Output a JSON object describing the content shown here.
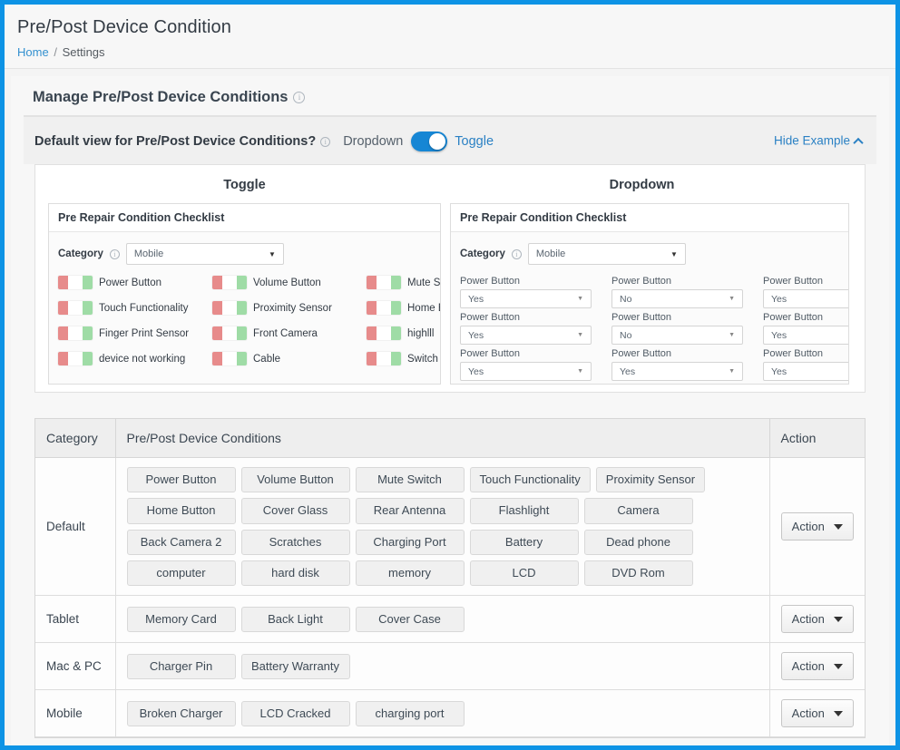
{
  "header": {
    "title": "Pre/Post Device Condition",
    "breadcrumb": {
      "home": "Home",
      "separator": "/",
      "current": "Settings"
    }
  },
  "card": {
    "title": "Manage Pre/Post Device Conditions"
  },
  "default_view": {
    "label": "Default view for Pre/Post Device Conditions?",
    "option_off": "Dropdown",
    "option_on": "Toggle",
    "toggle_state": "on",
    "accent_color": "#1686d4",
    "hide_example_label": "Hide Example"
  },
  "example": {
    "toggle": {
      "heading": "Toggle",
      "card_title": "Pre Repair Condition Checklist",
      "category_label": "Category",
      "category_value": "Mobile",
      "items": [
        "Power Button",
        "Volume Button",
        "Mute Switch",
        "Touch Functionality",
        "Proximity Sensor",
        "Home Button",
        "Finger Print Sensor",
        "Front Camera",
        "highlll",
        "device not working",
        "Cable",
        "Switch"
      ],
      "switch_off_color": "#e78b8b",
      "switch_on_color": "#9fdca6"
    },
    "dropdown": {
      "heading": "Dropdown",
      "card_title": "Pre Repair Condition Checklist",
      "category_label": "Category",
      "category_value": "Mobile",
      "fields": [
        {
          "label": "Power Button",
          "value": "Yes"
        },
        {
          "label": "Power Button",
          "value": "No"
        },
        {
          "label": "Power Button",
          "value": "Yes"
        },
        {
          "label": "Power Button",
          "value": "Yes"
        },
        {
          "label": "Power Button",
          "value": "No"
        },
        {
          "label": "Power Button",
          "value": "Yes"
        },
        {
          "label": "Power Button",
          "value": "Yes"
        },
        {
          "label": "Power Button",
          "value": "Yes"
        },
        {
          "label": "Power Button",
          "value": "Yes"
        }
      ]
    }
  },
  "table": {
    "columns": [
      "Category",
      "Pre/Post Device Conditions",
      "Action"
    ],
    "action_label": "Action",
    "rows": [
      {
        "category": "Default",
        "conditions": [
          "Power Button",
          "Volume Button",
          "Mute Switch",
          "Touch Functionality",
          "Proximity Sensor",
          "Home Button",
          "Cover Glass",
          "Rear Antenna",
          "Flashlight",
          "Camera",
          "Back Camera 2",
          "Scratches",
          "Charging Port",
          "Battery",
          "Dead phone",
          "computer",
          "hard disk",
          "memory",
          "LCD",
          "DVD Rom"
        ]
      },
      {
        "category": "Tablet",
        "conditions": [
          "Memory Card",
          "Back Light",
          "Cover Case"
        ]
      },
      {
        "category": "Mac & PC",
        "conditions": [
          "Charger Pin",
          "Battery Warranty"
        ]
      },
      {
        "category": "Mobile",
        "conditions": [
          "Broken Charger",
          "LCD Cracked",
          "charging port"
        ]
      }
    ]
  }
}
